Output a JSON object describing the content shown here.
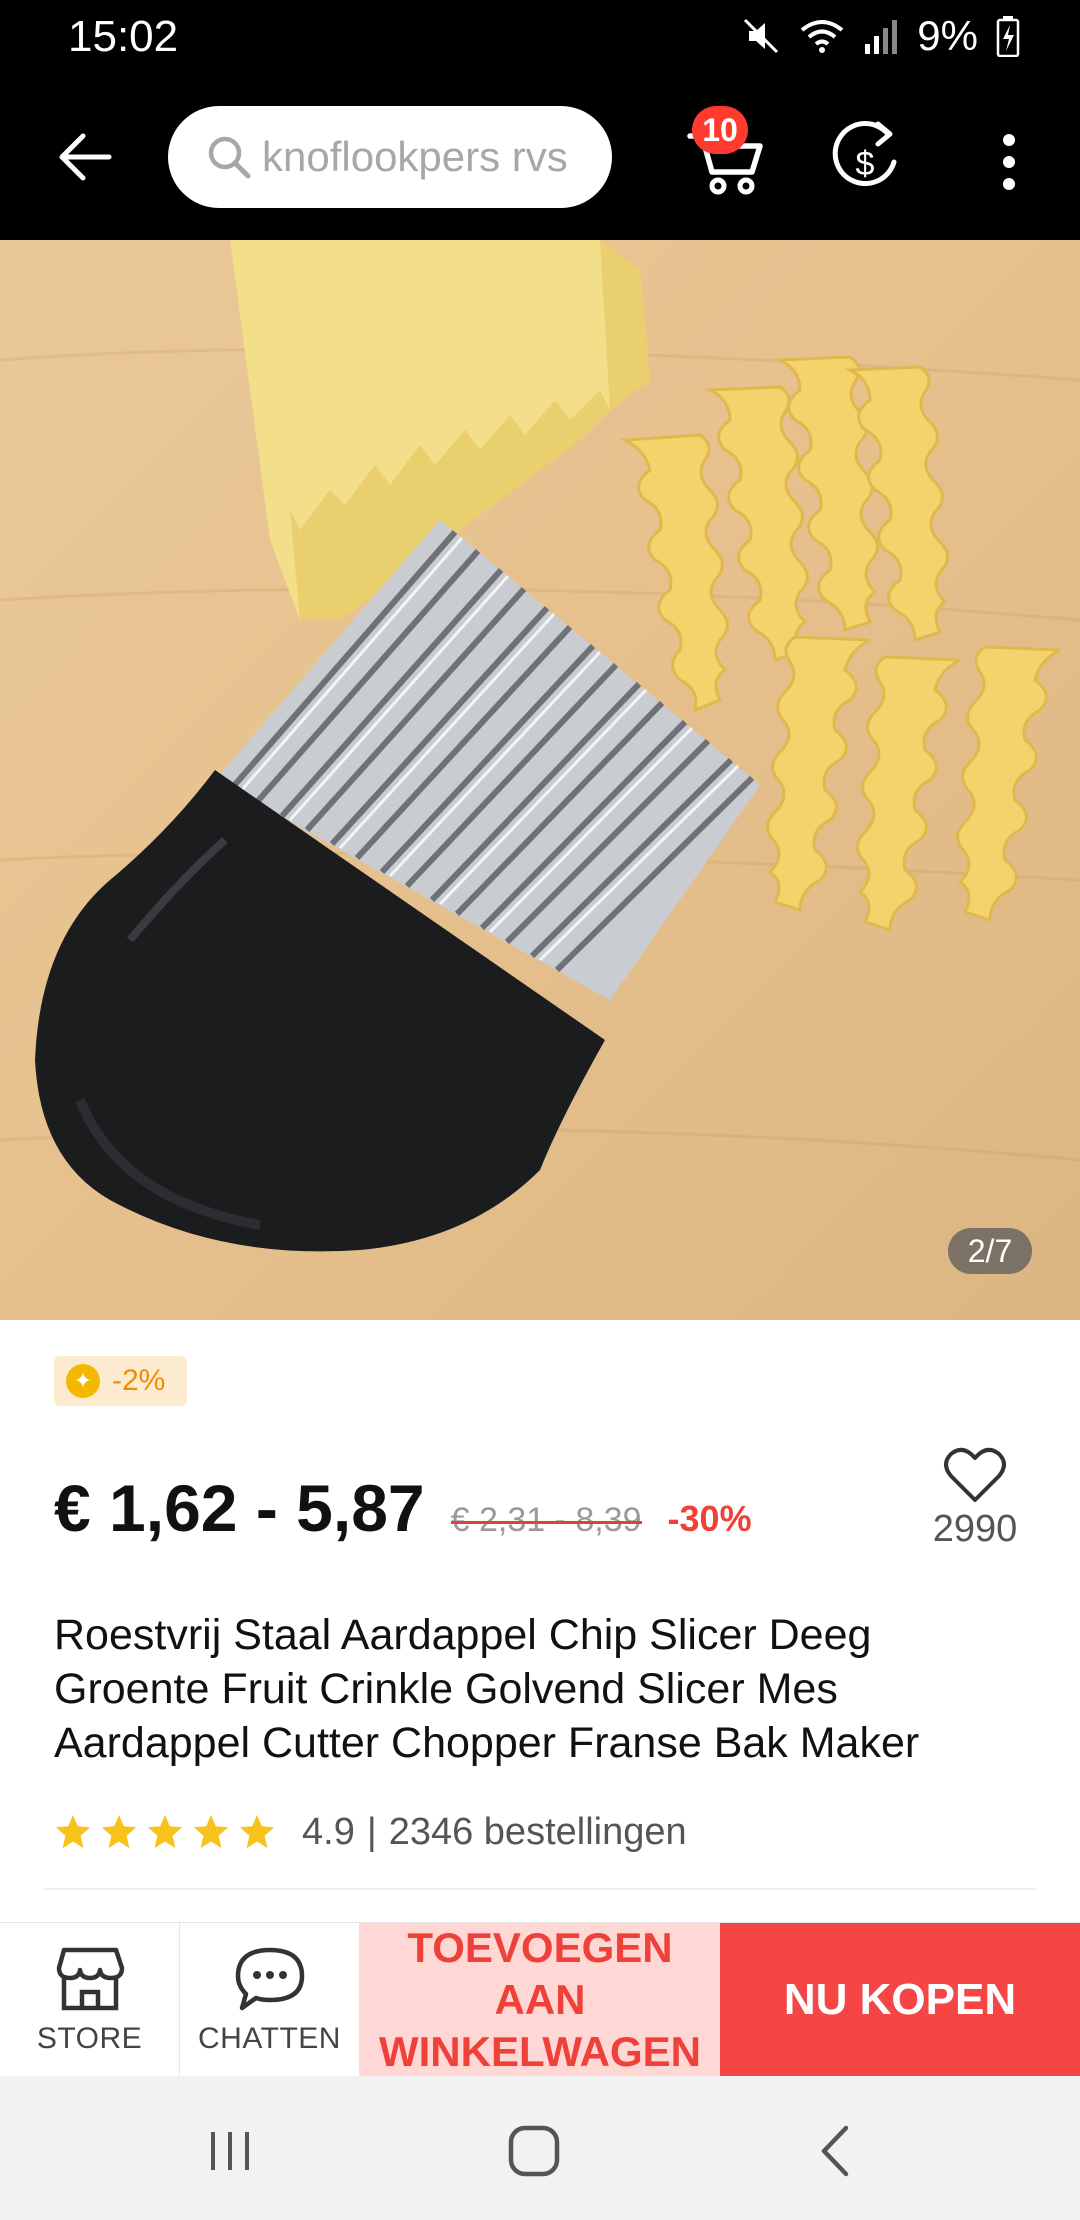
{
  "status_bar": {
    "time": "15:02",
    "battery_text": "9%",
    "icons": [
      "mute-icon",
      "wifi-icon",
      "signal-icon",
      "battery-charging-icon"
    ]
  },
  "app_bar": {
    "search_placeholder": "knoflookpers rvs",
    "cart_badge_count": "10",
    "icons": [
      "back-arrow-icon",
      "search-icon",
      "cart-icon",
      "currency-icon",
      "more-vertical-icon"
    ]
  },
  "gallery": {
    "counter": "2/7"
  },
  "product": {
    "coin_discount": "-2%",
    "price": "€ 1,62 - 5,87",
    "original_price": "€ 2,31 - 8,39",
    "discount_percent": "-30%",
    "wishlist_count": "2990",
    "title": "Roestvrij Staal Aardappel Chip Slicer Deeg Groente Fruit Crinkle Golvend Slicer Mes Aardappel Cutter Chopper Franse Bak Maker",
    "rating_stars": 5,
    "rating": "4.9",
    "rating_separator": "|",
    "orders": "2346 bestellingen"
  },
  "actions": {
    "store_label": "STORE",
    "chat_label": "CHATTEN",
    "add_to_cart_line1": "TOEVOEGEN AAN",
    "add_to_cart_line2": "WINKELWAGEN",
    "buy_now_label": "NU KOPEN"
  },
  "colors": {
    "accent_red": "#f54545",
    "add_cart_bg": "#ffd7d4",
    "coin_orange": "#f28c00",
    "star_yellow": "#f7c21b"
  }
}
